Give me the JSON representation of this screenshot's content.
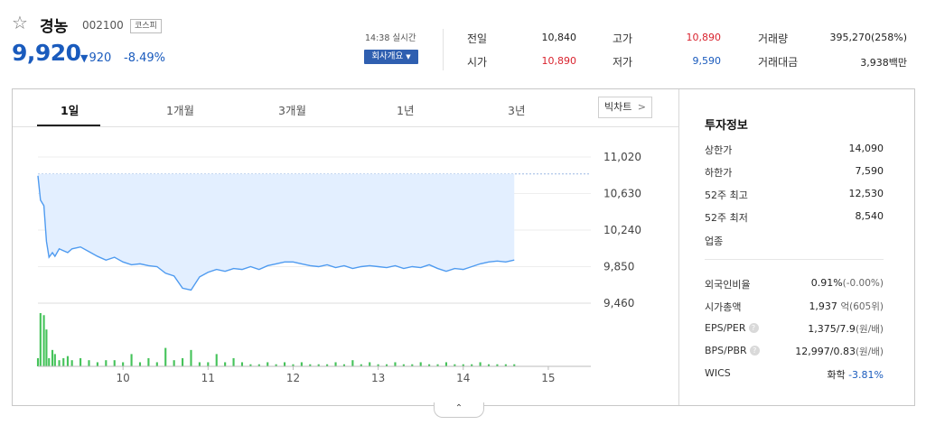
{
  "stock": {
    "name": "경농",
    "code": "002100",
    "market": "코스피",
    "price": "9,920",
    "change_symbol": "▼",
    "change": "920",
    "change_rate": "-8.49%",
    "realtime_label": "14:38 실시간",
    "company_button": "회사개요",
    "star_icon": "star-outline-icon"
  },
  "quote": {
    "prev_close_label": "전일",
    "prev_close": "10,840",
    "open_label": "시가",
    "open": "10,890",
    "high_label": "고가",
    "high": "10,890",
    "low_label": "저가",
    "low": "9,590",
    "volume_label": "거래량",
    "volume": "395,270(258%)",
    "amount_label": "거래대금",
    "amount": "3,938백만"
  },
  "tabs": [
    "1일",
    "1개월",
    "3개월",
    "1년",
    "3년"
  ],
  "big_chart_label": "빅차트",
  "panel": {
    "title": "투자정보",
    "upper_limit_label": "상한가",
    "upper_limit": "14,090",
    "lower_limit_label": "하한가",
    "lower_limit": "7,590",
    "week52_high_label": "52주 최고",
    "week52_high": "12,530",
    "week52_low_label": "52주 최저",
    "week52_low": "8,540",
    "sector_label": "업종",
    "foreign_label": "외국인비율",
    "foreign": "0.91%",
    "foreign_sub": "(-0.00%)",
    "market_cap_label": "시가총액",
    "market_cap": "1,937",
    "market_cap_sub": "억(605위)",
    "eps_per_label": "EPS/PER",
    "eps_per": "1,375/7.9",
    "eps_per_sub": "(원/배)",
    "bps_pbr_label": "BPS/PBR",
    "bps_pbr": "12,997/0.83",
    "bps_pbr_sub": "(원/배)",
    "wics_label": "WICS",
    "wics": "화학",
    "wics_change": "-3.81%"
  },
  "colors": {
    "down": "#1a5bbd",
    "up": "#d9232e",
    "volume_bar": "#45c35a",
    "area_fill": "#e3efff",
    "line": "#4f9bf0"
  },
  "chart_data": {
    "type": "area",
    "x_ticks": [
      "10",
      "11",
      "12",
      "13",
      "14",
      "15"
    ],
    "y_ticks": [
      "11,020",
      "10,630",
      "10,240",
      "9,850",
      "9,460"
    ],
    "y_tick_values": [
      11020,
      10630,
      10240,
      9850,
      9460
    ],
    "ylim": [
      9460,
      11020
    ],
    "xlim": [
      9,
      15.5
    ],
    "prev_close": 10840,
    "series": [
      {
        "x": [
          9.0,
          9.03,
          9.07,
          9.1,
          9.13,
          9.17,
          9.2,
          9.25,
          9.3,
          9.35,
          9.4,
          9.5,
          9.6,
          9.7,
          9.8,
          9.9,
          10.0,
          10.1,
          10.2,
          10.3,
          10.4,
          10.5,
          10.6,
          10.7,
          10.8,
          10.9,
          11.0,
          11.1,
          11.2,
          11.3,
          11.4,
          11.5,
          11.6,
          11.7,
          11.8,
          11.9,
          12.0,
          12.1,
          12.2,
          12.3,
          12.4,
          12.5,
          12.6,
          12.7,
          12.8,
          12.9,
          13.0,
          13.1,
          13.2,
          13.3,
          13.4,
          13.5,
          13.6,
          13.7,
          13.8,
          13.9,
          14.0,
          14.1,
          14.2,
          14.3,
          14.4,
          14.5,
          14.6
        ],
        "y": [
          10820,
          10560,
          10500,
          10120,
          9950,
          10000,
          9960,
          10040,
          10020,
          10000,
          10040,
          10060,
          10010,
          9960,
          9920,
          9950,
          9900,
          9870,
          9880,
          9860,
          9850,
          9780,
          9750,
          9620,
          9600,
          9740,
          9790,
          9820,
          9800,
          9830,
          9820,
          9850,
          9820,
          9860,
          9880,
          9900,
          9900,
          9880,
          9860,
          9850,
          9870,
          9840,
          9860,
          9830,
          9850,
          9860,
          9850,
          9840,
          9860,
          9830,
          9850,
          9840,
          9870,
          9830,
          9800,
          9830,
          9820,
          9850,
          9880,
          9900,
          9910,
          9900,
          9920
        ]
      }
    ],
    "volume": [
      4,
      26,
      25,
      18,
      4,
      8,
      6,
      3,
      4,
      5,
      3,
      4,
      3,
      2,
      3,
      3,
      2,
      6,
      2,
      4,
      2,
      9,
      3,
      4,
      8,
      2,
      2,
      6,
      2,
      4,
      2,
      1,
      1,
      2,
      1,
      2,
      1,
      2,
      1,
      1,
      1,
      2,
      1,
      3,
      1,
      2,
      1,
      1,
      2,
      1,
      1,
      2,
      1,
      1,
      2,
      1,
      1,
      1,
      2,
      1,
      1,
      1,
      1
    ]
  }
}
